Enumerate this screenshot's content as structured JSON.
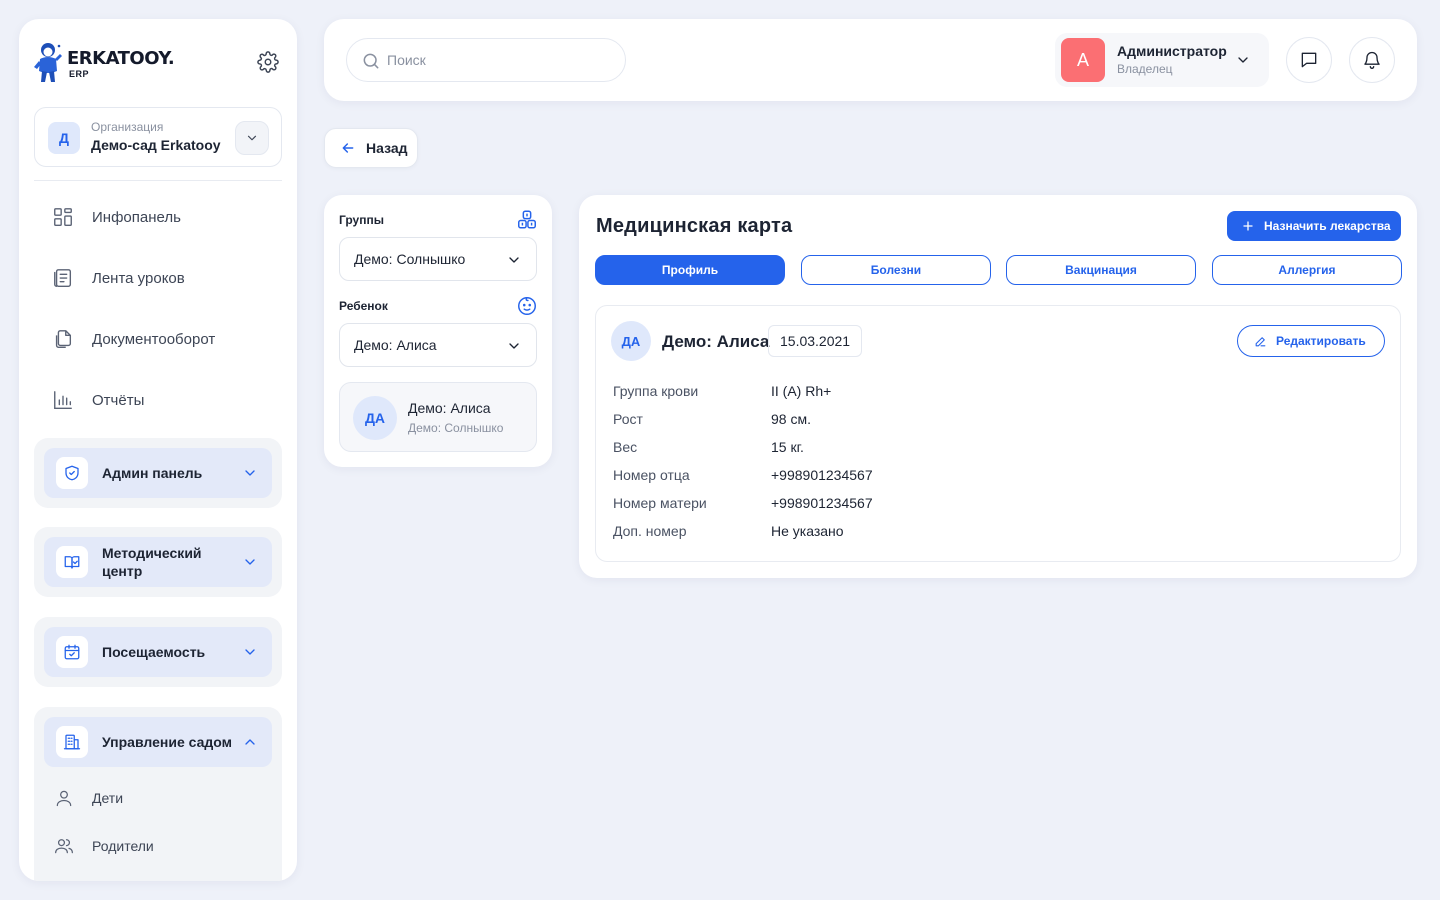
{
  "brand": {
    "name": "ERKATOOY.",
    "sub": "ERP"
  },
  "organization": {
    "label": "Организация",
    "name": "Демо-сад Erkatooy",
    "initial": "Д"
  },
  "nav": [
    {
      "label": "Инфопанель",
      "icon": "dashboard-icon"
    },
    {
      "label": "Лента уроков",
      "icon": "lessons-feed-icon"
    },
    {
      "label": "Документооборот",
      "icon": "documents-icon"
    },
    {
      "label": "Отчёты",
      "icon": "reports-chart-icon"
    }
  ],
  "groups": {
    "admin": {
      "label": "Админ панель",
      "icon": "shield-icon",
      "expanded": false
    },
    "method": {
      "label": "Методический центр",
      "icon": "book-icon",
      "expanded": false
    },
    "attendance": {
      "label": "Посещаемость",
      "icon": "calendar-check-icon",
      "expanded": false
    },
    "management": {
      "label": "Управление садом",
      "icon": "building-icon",
      "expanded": true,
      "items": [
        {
          "label": "Дети",
          "icon": "user-icon"
        },
        {
          "label": "Родители",
          "icon": "users-icon"
        }
      ]
    }
  },
  "search": {
    "placeholder": "Поиск",
    "value": ""
  },
  "user": {
    "initial": "A",
    "name": "Администратор",
    "role": "Владелец"
  },
  "back": {
    "label": "Назад"
  },
  "filters": {
    "groups_label": "Группы",
    "group_value": "Демо: Солнышко",
    "child_label": "Ребенок",
    "child_value": "Демо: Алиса",
    "card": {
      "initials": "ДА",
      "name": "Демо: Алиса",
      "group": "Демо: Солнышко"
    }
  },
  "medical": {
    "title": "Медицинская карта",
    "assign_label": "Назначить лекарства",
    "tabs": [
      {
        "label": "Профиль",
        "active": true
      },
      {
        "label": "Болезни",
        "active": false
      },
      {
        "label": "Вакцинация",
        "active": false
      },
      {
        "label": "Аллергия",
        "active": false
      }
    ],
    "profile": {
      "initials": "ДА",
      "name": "Демо: Алиса",
      "birth_date": "15.03.2021",
      "edit_label": "Редактировать",
      "rows": [
        {
          "key": "Группа крови",
          "value": "II (A) Rh+"
        },
        {
          "key": "Рост",
          "value": "98 см."
        },
        {
          "key": "Вес",
          "value": "15 кг."
        },
        {
          "key": "Номер отца",
          "value": "+998901234567"
        },
        {
          "key": "Номер матери",
          "value": "+998901234567"
        },
        {
          "key": "Доп. номер",
          "value": "Не указано"
        }
      ]
    }
  },
  "colors": {
    "accent": "#2563eb",
    "avatar_user": "#fb6f73",
    "background": "#eef1f9"
  }
}
